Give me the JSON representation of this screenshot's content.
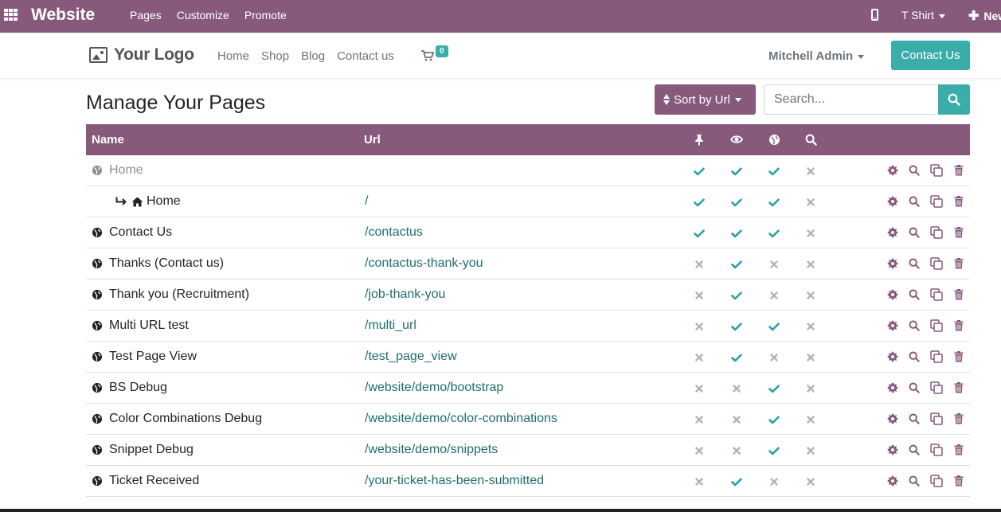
{
  "topbar": {
    "brand": "Website",
    "menu": [
      "Pages",
      "Customize",
      "Promote"
    ],
    "website_switch": "T Shirt",
    "new_label": "New"
  },
  "header": {
    "logo_text": "Your Logo",
    "nav": [
      "Home",
      "Shop",
      "Blog",
      "Contact us"
    ],
    "cart_count": "0",
    "user_name": "Mitchell Admin",
    "contact_button": "Contact Us"
  },
  "title": "Manage Your Pages",
  "sort_button": "Sort by Url",
  "search": {
    "placeholder": "Search..."
  },
  "table": {
    "headers": {
      "name": "Name",
      "url": "Url"
    },
    "header_icons": [
      "pin-icon",
      "eye-icon",
      "globe-icon",
      "search-icon"
    ],
    "rows": [
      {
        "name": "Home",
        "url": "",
        "type": "menu",
        "pin": true,
        "visible": true,
        "published": true,
        "indexed": false
      },
      {
        "name": "Home",
        "url": "/",
        "type": "sub",
        "pin": true,
        "visible": true,
        "published": true,
        "indexed": false
      },
      {
        "name": "Contact Us",
        "url": "/contactus",
        "type": "page",
        "pin": true,
        "visible": true,
        "published": true,
        "indexed": false
      },
      {
        "name": "Thanks (Contact us)",
        "url": "/contactus-thank-you",
        "type": "page",
        "pin": false,
        "visible": true,
        "published": false,
        "indexed": false
      },
      {
        "name": "Thank you (Recruitment)",
        "url": "/job-thank-you",
        "type": "page",
        "pin": false,
        "visible": true,
        "published": false,
        "indexed": false
      },
      {
        "name": "Multi URL test",
        "url": "/multi_url",
        "type": "page",
        "pin": false,
        "visible": true,
        "published": true,
        "indexed": false
      },
      {
        "name": "Test Page View",
        "url": "/test_page_view",
        "type": "page",
        "pin": false,
        "visible": true,
        "published": false,
        "indexed": false
      },
      {
        "name": "BS Debug",
        "url": "/website/demo/bootstrap",
        "type": "page",
        "pin": false,
        "visible": false,
        "published": true,
        "indexed": false
      },
      {
        "name": "Color Combinations Debug",
        "url": "/website/demo/color-combinations",
        "type": "page",
        "pin": false,
        "visible": false,
        "published": true,
        "indexed": false
      },
      {
        "name": "Snippet Debug",
        "url": "/website/demo/snippets",
        "type": "page",
        "pin": false,
        "visible": false,
        "published": true,
        "indexed": false
      },
      {
        "name": "Ticket Received",
        "url": "/your-ticket-has-been-submitted",
        "type": "page",
        "pin": false,
        "visible": true,
        "published": false,
        "indexed": false
      }
    ],
    "row_actions": [
      "gear-icon",
      "search-icon",
      "clone-icon",
      "trash-icon"
    ]
  },
  "colors": {
    "primary": "#875a7b",
    "accent": "#3aadaa",
    "check": "#2aa1a8",
    "cross": "#adb5bd",
    "link": "#1f6e6c"
  }
}
